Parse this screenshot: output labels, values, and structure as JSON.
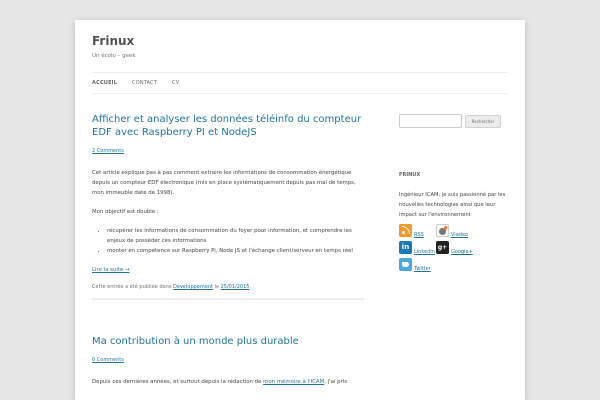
{
  "site": {
    "title": "Frinux",
    "description": "Un écolo – geek"
  },
  "nav": {
    "items": [
      {
        "label": "ACCUEIL"
      },
      {
        "label": "CONTACT"
      },
      {
        "label": "CV"
      }
    ]
  },
  "posts": [
    {
      "title": "Afficher et analyser les données téléinfo du compteur EDF avec Raspberry PI et NodeJS",
      "comments": "2 Comments",
      "paragraph1": "Cet article explique pas à pas comment extraire les informations de consommation énergétique depuis un compteur EDF électronique (mis en place systématiquement depuis pas mal de temps, mon immeuble date de 1998).",
      "paragraph2": "Mon objectif est double :",
      "bullets": [
        "récupérer les informations de consommation du foyer pour information, et comprendre les enjeux de posséder ces informations",
        "monter en compétence sur Raspberry Pi, Node JS et l'échange client/serveur en temps réel"
      ],
      "more": "Lire la suite →",
      "meta_prefix": "Cette entrée a été publiée dans",
      "meta_category": "Développement",
      "meta_middle": "le",
      "meta_date": "25/01/2015",
      "meta_suffix": "."
    },
    {
      "title": "Ma contribution à un monde plus durable",
      "comments": "0 Comments",
      "paragraph_start": "Depuis ces dernières années, et surtout depuis la rédaction de",
      "paragraph_link": "mon mémoire à l'ICAM",
      "paragraph_end": ", j'ai pris"
    }
  ],
  "sidebar": {
    "search_button": "Rechercher",
    "widget_title": "FRINUX",
    "widget_text": "Ingénieur ICAM, je suis passionné par les nouvelles technologies ainsi que leur impact sur l'environnement",
    "social": [
      {
        "label": "RSS",
        "icon": "rss-icon"
      },
      {
        "label": "Viadeo",
        "icon": "viadeo-icon"
      },
      {
        "label": "LinkedIn",
        "icon": "linkedin-icon",
        "glyph": "in"
      },
      {
        "label": "Google+",
        "icon": "google-plus-icon",
        "glyph": "g+"
      },
      {
        "label": "Twitter",
        "icon": "twitter-icon"
      }
    ]
  },
  "colors": {
    "link": "#21759b",
    "background": "#e6e6e6",
    "rss": "#f39a2b",
    "linkedin": "#1d79b5",
    "twitter": "#49a9dd"
  }
}
